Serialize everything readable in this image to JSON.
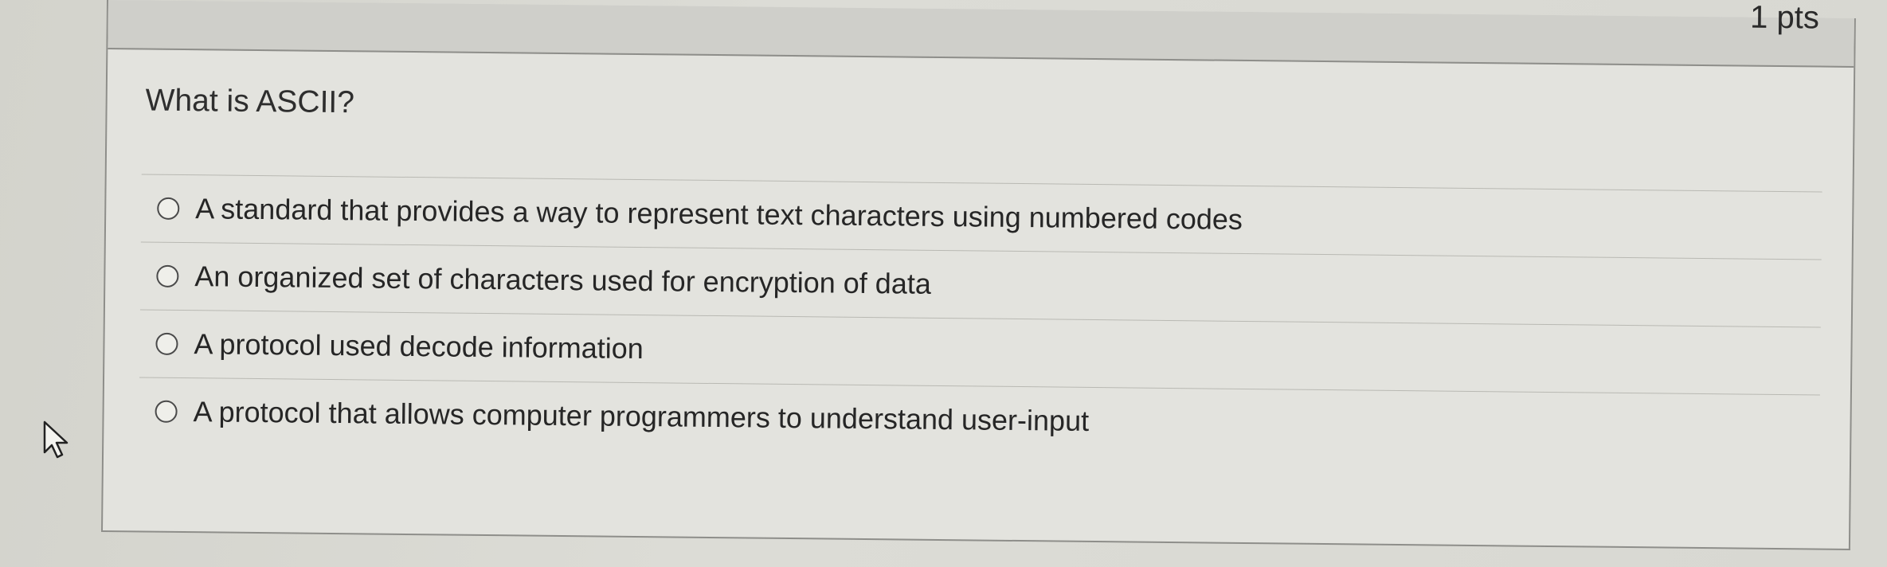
{
  "quiz": {
    "points_label": "1 pts",
    "question_text": "What is ASCII?",
    "answers": [
      {
        "label": "A standard that provides a way to represent text characters using numbered codes"
      },
      {
        "label": "An organized set of characters used for encryption of data"
      },
      {
        "label": "A protocol used decode information"
      },
      {
        "label": "A protocol that allows computer programmers to understand user-input"
      }
    ]
  },
  "icons": {
    "radio": "radio-button-unselected-icon",
    "cursor": "mouse-pointer-icon"
  }
}
